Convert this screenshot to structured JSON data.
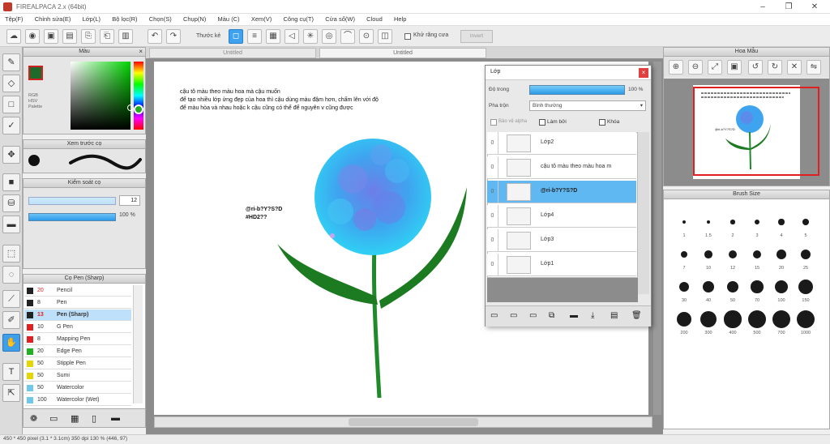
{
  "window": {
    "title": "FIREALPACA 2.x (64bit)"
  },
  "menu": [
    "Tệp(F)",
    "Chỉnh sửa(E)",
    "Lớp(L)",
    "Bộ lọc(R)",
    "Chọn(S)",
    "Chụp(N)",
    "Màu (C)",
    "Xem(V)",
    "Công cụ(T)",
    "Cửa sổ(W)",
    "Cloud",
    "Help"
  ],
  "toolbar": {
    "thuoc_label": "Thước kẻ",
    "no_label": "Khử răng cưa",
    "btn_label": "Invert"
  },
  "tabs": [
    "Untitled",
    "Untitled"
  ],
  "color_panel": {
    "title": "Màu",
    "values": [
      "RGB",
      "HSV",
      "Palette"
    ]
  },
  "brush_preview": {
    "title": "Xem trước cọ"
  },
  "brush_settings": {
    "title": "Kiểm soát cọ",
    "size": "12",
    "opacity": "100 %"
  },
  "brush_list": {
    "title": "Cọ Pen (Sharp)",
    "items": [
      {
        "size": "20",
        "name": "Pencil",
        "color": "#222222"
      },
      {
        "size": "8",
        "name": "Pen",
        "color": "#222222"
      },
      {
        "size": "13",
        "name": "Pen (Sharp)",
        "color": "#222222"
      },
      {
        "size": "10",
        "name": "G Pen",
        "color": "#e02020"
      },
      {
        "size": "8",
        "name": "Mapping Pen",
        "color": "#e02020"
      },
      {
        "size": "20",
        "name": "Edge Pen",
        "color": "#20b020"
      },
      {
        "size": "50",
        "name": "Stipple Pen",
        "color": "#e6d600"
      },
      {
        "size": "50",
        "name": "Sumi",
        "color": "#e6d600"
      },
      {
        "size": "50",
        "name": "Watercolor",
        "color": "#6ec8ea"
      },
      {
        "size": "100",
        "name": "Watercolor (Wet)",
        "color": "#6ec8ea"
      }
    ]
  },
  "canvas_text": {
    "line1": "cậu tô màu theo màu hoa mà cậu muốn",
    "line2": "để tạo nhiều lớp ửng đẹp của hoa thì cậu dùng màu đậm hơn, chấm lên với độ",
    "line3": "để màu hòa và nhau hoặc k cậu cũng có thể để nguyên v cũng được",
    "tag1": "@ri-b?Y?S?D",
    "tag2": "#HD2??"
  },
  "layer_panel": {
    "title": "Lớp",
    "opacity_label": "Độ trong",
    "opacity_value": "100 %",
    "blend_label": "Pha trộn",
    "blend_value": "Bình thường",
    "check1": "Bảo vệ alpha",
    "check2": "Làm bởi",
    "check3": "Khóa",
    "layers": [
      {
        "name": "Lớp2",
        "sel": false
      },
      {
        "name": "cậu tô màu theo màu hoa m",
        "sel": false
      },
      {
        "name": "@ri-b?Y?S?D",
        "sel": true
      },
      {
        "name": "Lớp4",
        "sel": false
      },
      {
        "name": "Lớp3",
        "sel": false
      },
      {
        "name": "Lớp1",
        "sel": false
      }
    ]
  },
  "navigator": {
    "title": "Hoa Mẫu"
  },
  "brush_size_panel": {
    "title": "Brush Size",
    "sizes": [
      "1",
      "1.5",
      "2",
      "3",
      "4",
      "5",
      "7",
      "10",
      "12",
      "15",
      "20",
      "25",
      "30",
      "40",
      "50",
      "70",
      "100",
      "150",
      "200",
      "300",
      "400",
      "500",
      "700",
      "1000"
    ]
  },
  "status": {
    "text": "450 * 450 pixel (3.1 * 3.1cm) 350 dpi 130 % (446, 97)"
  }
}
